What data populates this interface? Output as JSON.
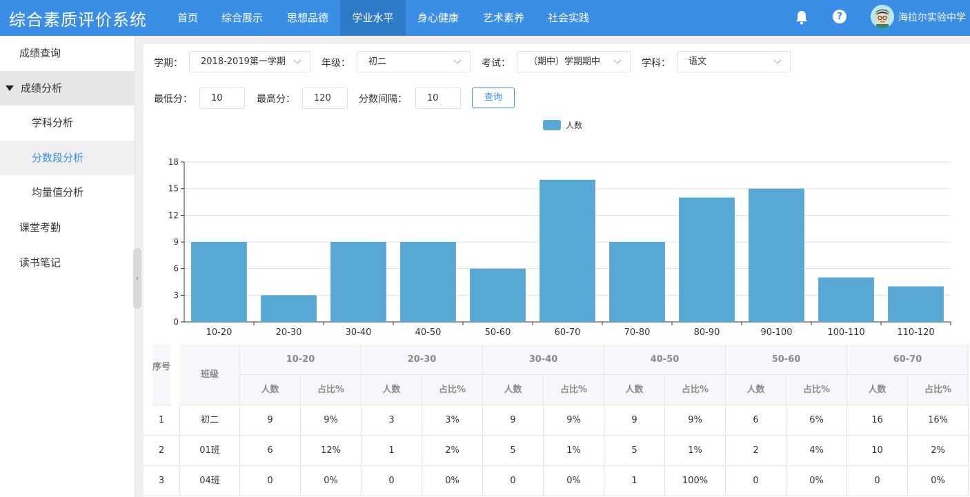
{
  "app": {
    "title": "综合素质评价系统"
  },
  "nav": [
    {
      "label": "首页"
    },
    {
      "label": "综合展示"
    },
    {
      "label": "思想品德"
    },
    {
      "label": "学业水平"
    },
    {
      "label": "身心健康"
    },
    {
      "label": "艺术素养"
    },
    {
      "label": "社会实践"
    }
  ],
  "nav_active": "学业水平",
  "user": {
    "school": "海拉尔实验中学",
    "help_glyph": "?"
  },
  "sidebar": {
    "items": [
      {
        "label": "成绩查询"
      },
      {
        "label": "成绩分析"
      },
      {
        "label": "学科分析"
      },
      {
        "label": "分数段分析"
      },
      {
        "label": "均量值分析"
      },
      {
        "label": "课堂考勤"
      },
      {
        "label": "读书笔记"
      }
    ],
    "collapse_glyph": "‹"
  },
  "filters": {
    "term_label": "学期：",
    "term_value": "2018-2019第一学期",
    "grade_label": "年级：",
    "grade_value": "初二",
    "exam_label": "考试：",
    "exam_value": "（期中）学期期中",
    "subject_label": "学科：",
    "subject_value": "语文",
    "min_label": "最低分：",
    "min_value": "10",
    "max_label": "最高分：",
    "max_value": "120",
    "interval_label": "分数间隔：",
    "interval_value": "10",
    "query_label": "查询"
  },
  "chart_data": {
    "type": "bar",
    "categories": [
      "10-20",
      "20-30",
      "30-40",
      "40-50",
      "50-60",
      "60-70",
      "70-80",
      "80-90",
      "90-100",
      "100-110",
      "110-120"
    ],
    "series": [
      {
        "name": "人数",
        "values": [
          9,
          3,
          9,
          9,
          6,
          16,
          9,
          14,
          15,
          5,
          4
        ]
      }
    ],
    "ylim": [
      0,
      18
    ],
    "yticks": [
      "0",
      "3",
      "6",
      "9",
      "12",
      "15",
      "18"
    ],
    "grid": true,
    "legend": "top-center",
    "color": "#58a8d6"
  },
  "table": {
    "index_header": "序号",
    "class_header": "班级",
    "ranges": [
      "10-20",
      "20-30",
      "30-40",
      "40-50",
      "50-60",
      "60-70"
    ],
    "count_header": "人数",
    "pct_header": "占比%",
    "rows": [
      {
        "idx": "1",
        "name": "初二",
        "cells": [
          "9",
          "9%",
          "3",
          "3%",
          "9",
          "9%",
          "9",
          "9%",
          "6",
          "6%",
          "16",
          "16%"
        ]
      },
      {
        "idx": "2",
        "name": "01班",
        "cells": [
          "6",
          "12%",
          "1",
          "2%",
          "5",
          "1%",
          "5",
          "1%",
          "2",
          "4%",
          "10",
          "2%"
        ]
      },
      {
        "idx": "3",
        "name": "04班",
        "cells": [
          "0",
          "0%",
          "0",
          "0%",
          "0",
          "0%",
          "1",
          "100%",
          "0",
          "0%",
          "0",
          "0%"
        ]
      }
    ]
  }
}
